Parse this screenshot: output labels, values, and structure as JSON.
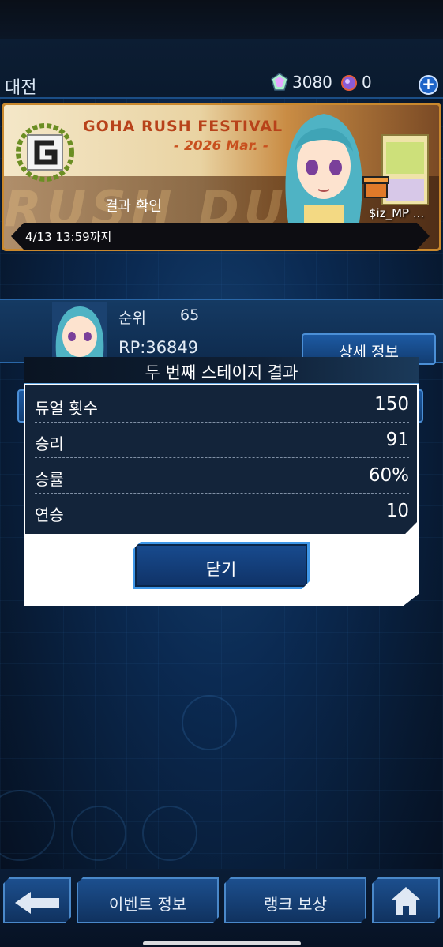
{
  "header": {
    "title": "대전",
    "gems": "3080",
    "orbs": "0",
    "add_label": "+"
  },
  "banner": {
    "title": "GOHA RUSH FESTIVAL",
    "subtitle": "- 2026 Mar. -",
    "watermark": "RUSH DUEL",
    "result_label": "결과 확인",
    "user": "$iz_MP ...",
    "deadline": "4/13 13:59까지"
  },
  "rank": {
    "rank_label": "순위",
    "rank_value": "65",
    "rp": "RP:36849",
    "detail_button": "상세 정보"
  },
  "dialog": {
    "title": "두 번째 스테이지 결과",
    "stats": [
      {
        "label": "듀얼 횟수",
        "value": "150"
      },
      {
        "label": "승리",
        "value": "91"
      },
      {
        "label": "승률",
        "value": "60%"
      },
      {
        "label": "연승",
        "value": "10"
      }
    ],
    "close_label": "닫기"
  },
  "bottom_nav": {
    "back": "←",
    "event_info": "이벤트 정보",
    "rank_reward": "랭크 보상",
    "home": "home"
  },
  "colors": {
    "accent": "#3f97e8",
    "banner_gold": "#c9882d",
    "title_red": "#b8421a"
  }
}
